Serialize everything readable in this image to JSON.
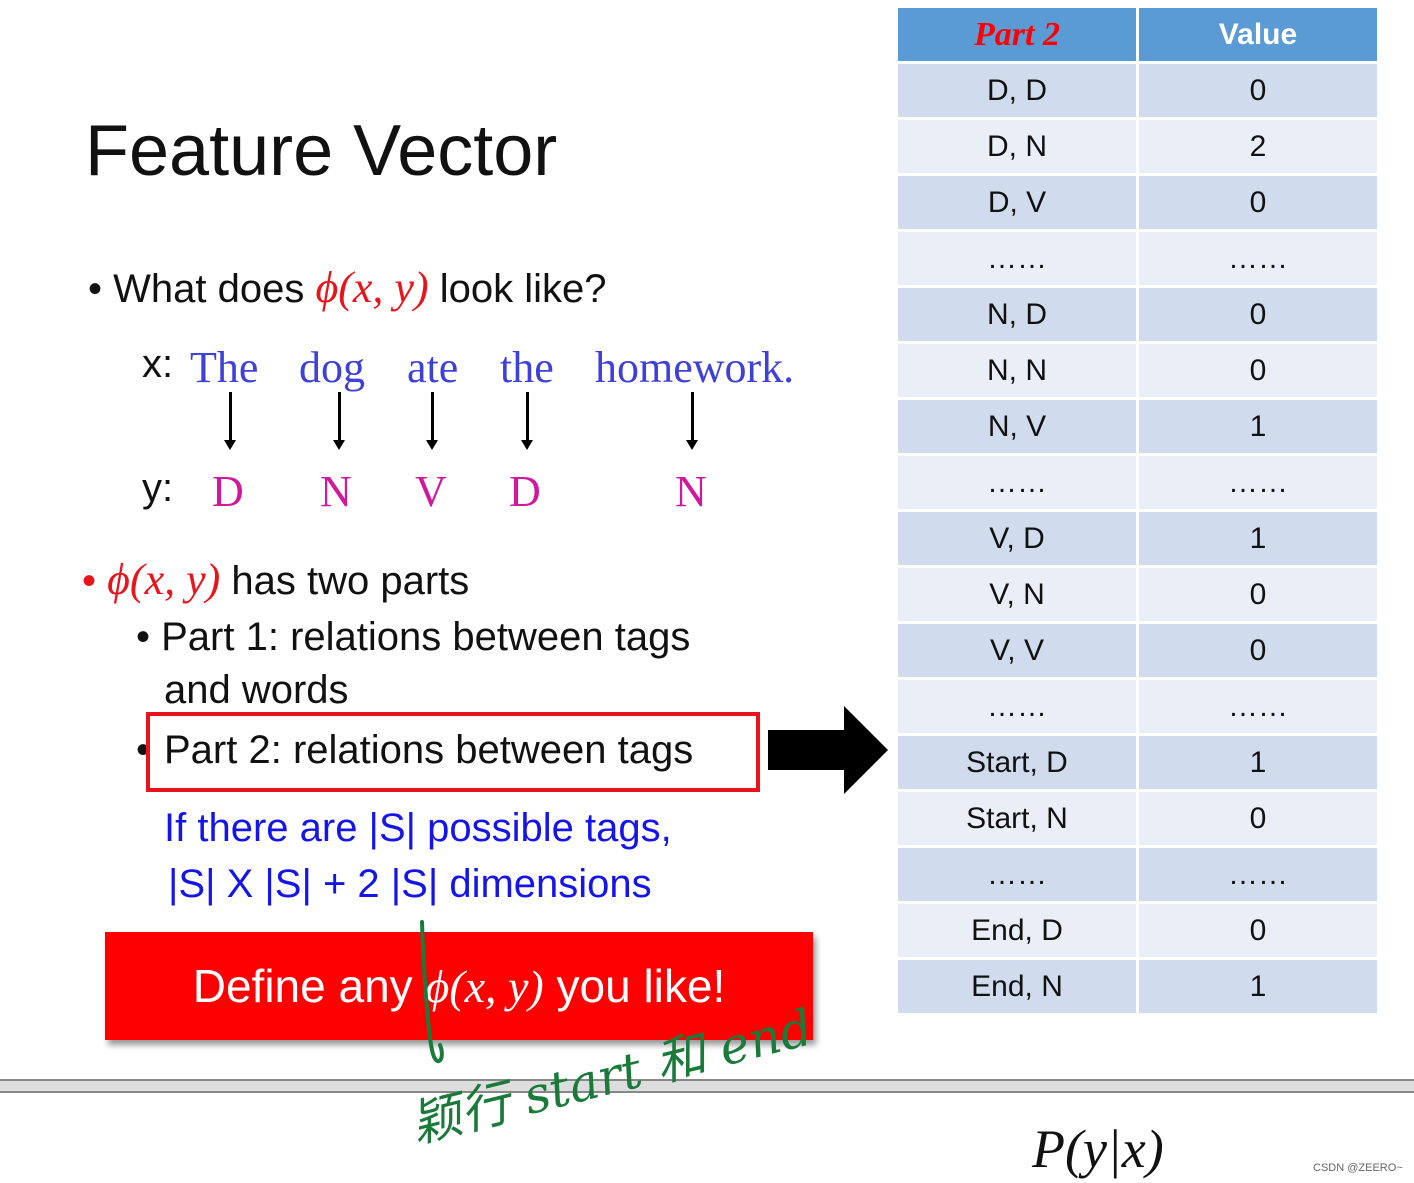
{
  "title": "Feature Vector",
  "bullet1": {
    "prefix": "What does ",
    "math": "ϕ(x, y)",
    "suffix": " look like?"
  },
  "example": {
    "x_label": "x:",
    "y_label": "y:",
    "words": [
      "The",
      "dog",
      "ate",
      "the",
      "homework."
    ],
    "tags": [
      "D",
      "N",
      "V",
      "D",
      "N"
    ]
  },
  "bullet2": {
    "math": "ϕ(x, y)",
    "suffix": " has two parts"
  },
  "sub1": {
    "line1": "Part 1: relations between tags",
    "line2": "and words"
  },
  "sub2": "Part 2: relations between tags",
  "note": {
    "line1": "If there are |S| possible tags,",
    "line2": "|S| X |S| + 2 |S| dimensions"
  },
  "define_box": {
    "prefix": "Define any ",
    "math": "ϕ(x, y)",
    "suffix": " you like!"
  },
  "table": {
    "headers": [
      "Part 2",
      "Value"
    ],
    "rows": [
      [
        "D, D",
        "0"
      ],
      [
        "D, N",
        "2"
      ],
      [
        "D, V",
        "0"
      ],
      [
        "……",
        "……"
      ],
      [
        "N, D",
        "0"
      ],
      [
        "N, N",
        "0"
      ],
      [
        "N, V",
        "1"
      ],
      [
        "……",
        "……"
      ],
      [
        "V, D",
        "1"
      ],
      [
        "V, N",
        "0"
      ],
      [
        "V, V",
        "0"
      ],
      [
        "……",
        "……"
      ],
      [
        "Start, D",
        "1"
      ],
      [
        "Start, N",
        "0"
      ],
      [
        "……",
        "……"
      ],
      [
        "End, D",
        "0"
      ],
      [
        "End, N",
        "1"
      ]
    ]
  },
  "formula": "P(y|x)",
  "handwriting": "颖行 start 和 end",
  "watermark": "CSDN @ZEERO~",
  "colors": {
    "accent_red": "#ff0000",
    "header_blue": "#5b9bd5",
    "ink_green": "#1a7a3a"
  }
}
